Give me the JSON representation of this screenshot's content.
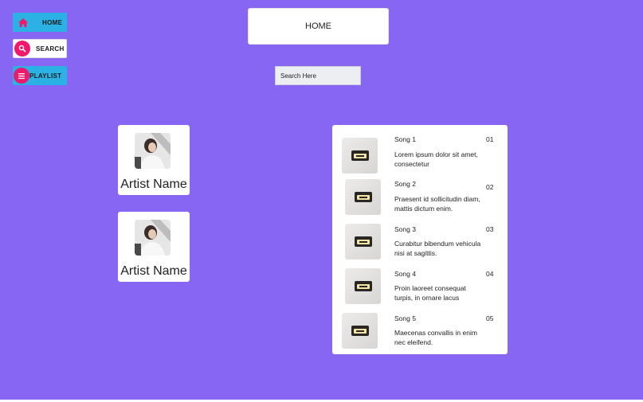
{
  "nav": {
    "home_label": "HOME",
    "search_label": "SEARCH",
    "playlist_label": "PLAYLIST",
    "home_icon": "home-icon",
    "search_icon": "search-icon",
    "playlist_icon": "list-icon"
  },
  "header": {
    "title": "HOME"
  },
  "search": {
    "placeholder": "Search Here"
  },
  "artists": [
    {
      "name": "Artist Name"
    },
    {
      "name": "Artist Name"
    }
  ],
  "songs": [
    {
      "title": "Song 1",
      "description": "Lorem ipsum dolor sit amet, consectetur",
      "number": "01"
    },
    {
      "title": "Song 2",
      "description": "Praesent id sollicitudin diam, mattis dictum enim.",
      "number": "02"
    },
    {
      "title": "Song 3",
      "description": "Curabitur bibendum vehicula nisi at sagittis.",
      "number": "03"
    },
    {
      "title": "Song 4",
      "description": "Proin laoreet consequat turpis, in ornare lacus",
      "number": "04"
    },
    {
      "title": "Song 5",
      "description": "Maecenas convallis in enim nec eleifend.",
      "number": "05"
    }
  ],
  "colors": {
    "background": "#8766f4",
    "nav_active": "#2bb1e3",
    "icon_accent": "#f0186a",
    "card": "#ffffff"
  }
}
